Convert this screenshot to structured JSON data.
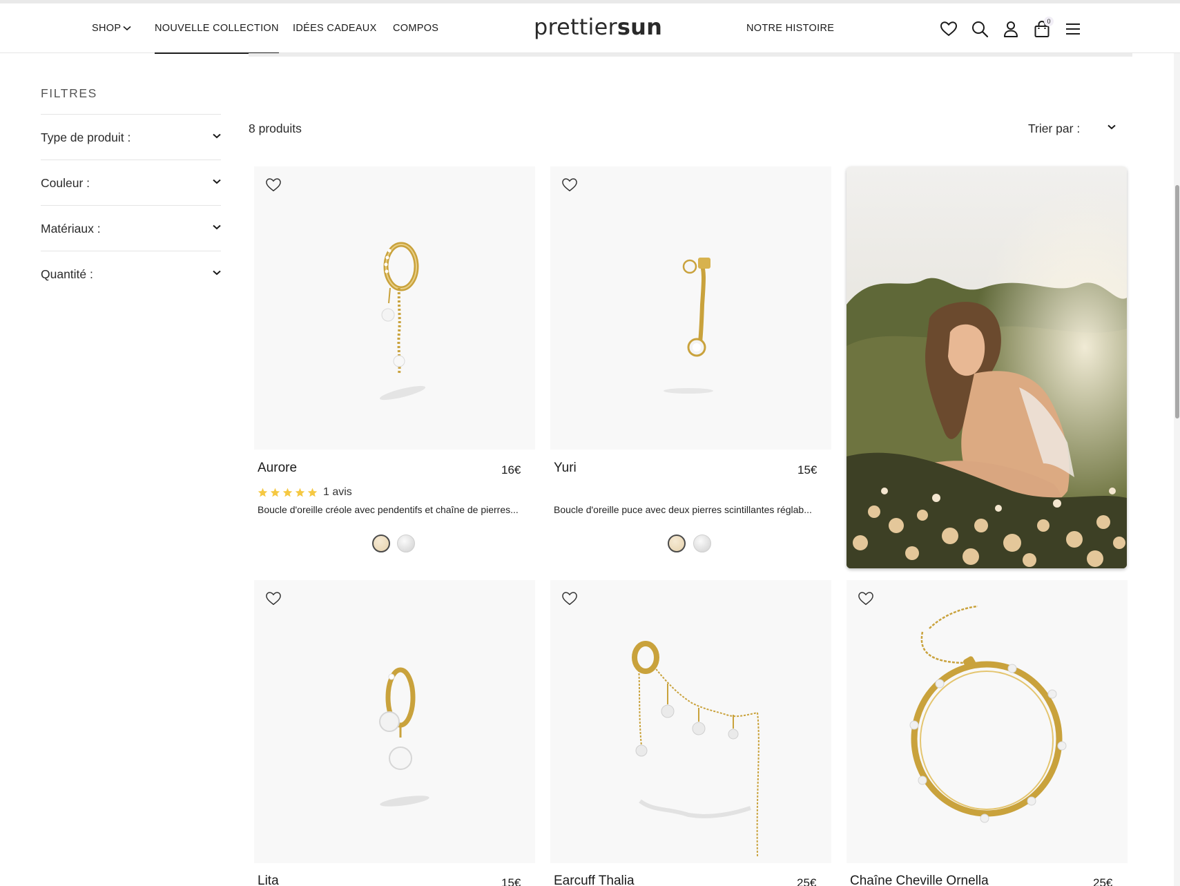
{
  "header": {
    "nav": [
      {
        "label": "SHOP"
      },
      {
        "label": "NOUVELLE COLLECTION"
      },
      {
        "label": "IDÉES CADEAUX"
      },
      {
        "label": "COMPOS"
      }
    ],
    "logo_light": "prettier",
    "logo_bold": "sun",
    "right_nav": "NOTRE HISTOIRE",
    "cart_count": "0",
    "icons": [
      "heart-icon",
      "search-icon",
      "user-icon",
      "cart-icon",
      "menu-icon"
    ]
  },
  "sidebar": {
    "title": "FILTRES",
    "filters": [
      {
        "label": "Type de produit :"
      },
      {
        "label": "Couleur :"
      },
      {
        "label": "Matériaux :"
      },
      {
        "label": "Quantité :"
      }
    ]
  },
  "toolbar": {
    "count": "8 produits",
    "sort_label": "Trier par :"
  },
  "products": [
    {
      "name": "Aurore",
      "price": "16€",
      "rating": 5,
      "reviews": "1 avis",
      "description": "Boucle d'oreille créole avec pendentifs et chaîne de pierres...",
      "swatches": [
        "gold",
        "silver"
      ]
    },
    {
      "name": "Yuri",
      "price": "15€",
      "description": "Boucle d'oreille puce avec deux pierres scintillantes réglab...",
      "swatches": [
        "gold",
        "silver"
      ]
    },
    {
      "name": "Lita",
      "price": "15€"
    },
    {
      "name": "Earcuff Thalia",
      "price": "25€"
    },
    {
      "name": "Chaîne Cheville Ornella",
      "price": "25€"
    }
  ],
  "colors": {
    "gold": "#c9a23c",
    "star": "#f5c842",
    "card_bg": "#f8f8f8",
    "text": "#1a1a1a"
  }
}
